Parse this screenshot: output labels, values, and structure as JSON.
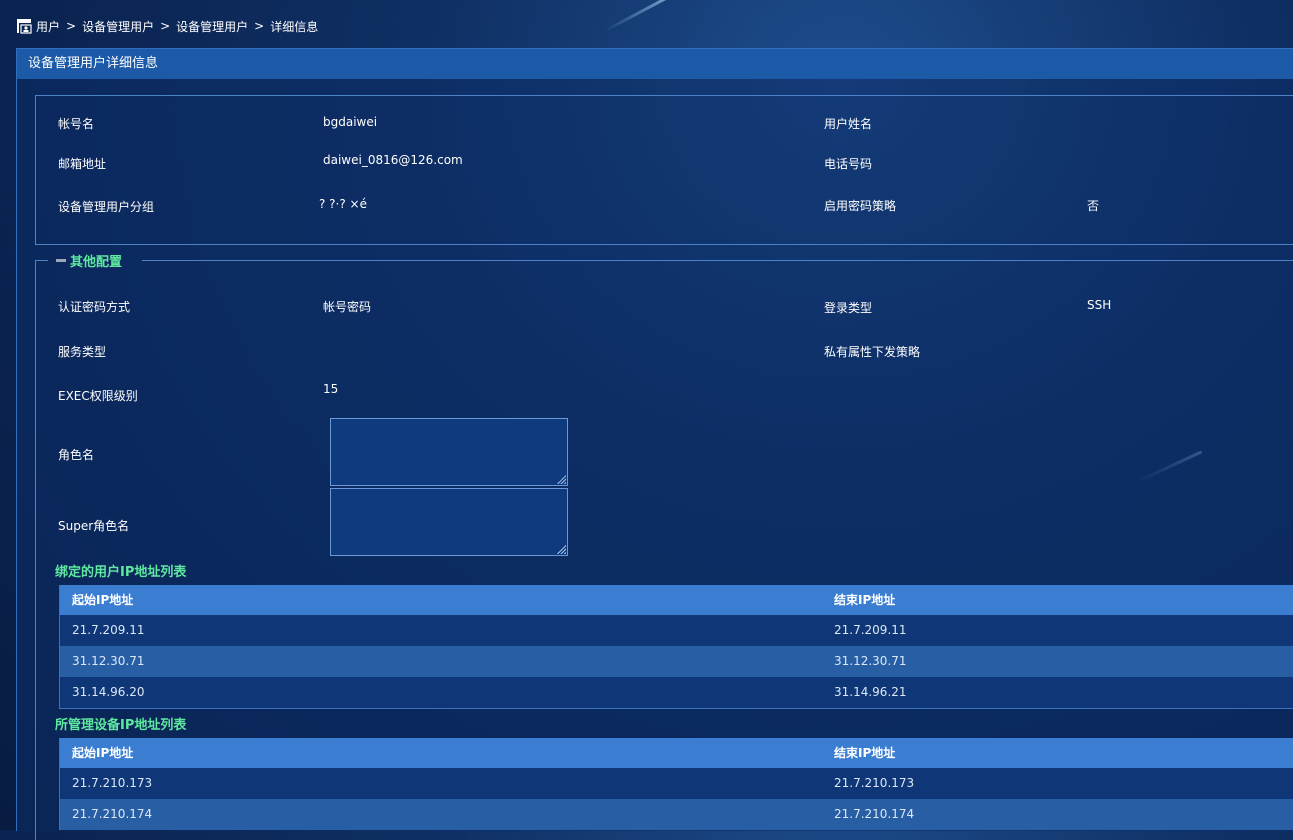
{
  "breadcrumb": {
    "items": [
      "用户",
      "设备管理用户",
      "设备管理用户",
      "详细信息"
    ],
    "separator": ">"
  },
  "panel": {
    "title": "设备管理用户详细信息"
  },
  "info": {
    "account_label": "帐号名",
    "account_value": "bgdaiwei",
    "username_label": "用户姓名",
    "username_value": "",
    "email_label": "邮箱地址",
    "email_value": "daiwei_0816@126.com",
    "phone_label": "电话号码",
    "phone_value": "",
    "group_label": "设备管理用户分组",
    "group_value": "? ?·? ×é",
    "pwd_policy_label": "启用密码策略",
    "pwd_policy_value": "否"
  },
  "other": {
    "legend": "其他配置",
    "auth_label": "认证密码方式",
    "auth_value": "帐号密码",
    "login_type_label": "登录类型",
    "login_type_value": "SSH",
    "service_type_label": "服务类型",
    "service_type_value": "",
    "private_attr_label": "私有属性下发策略",
    "private_attr_value": "",
    "exec_label": "EXEC权限级别",
    "exec_value": "15",
    "role_label": "角色名",
    "role_value": "",
    "super_role_label": "Super角色名",
    "super_role_value": ""
  },
  "user_ip_table": {
    "title": "绑定的用户IP地址列表",
    "headers": [
      "起始IP地址",
      "结束IP地址"
    ],
    "rows": [
      [
        "21.7.209.11",
        "21.7.209.11"
      ],
      [
        "31.12.30.71",
        "31.12.30.71"
      ],
      [
        "31.14.96.20",
        "31.14.96.21"
      ]
    ]
  },
  "device_ip_table": {
    "title": "所管理设备IP地址列表",
    "headers": [
      "起始IP地址",
      "结束IP地址"
    ],
    "rows": [
      [
        "21.7.210.173",
        "21.7.210.173"
      ],
      [
        "21.7.210.174",
        "21.7.210.174"
      ]
    ]
  },
  "colors": {
    "background": "#0f2f63",
    "header_bar": "#1c5aa8",
    "accent_green": "#5ee8a0",
    "table_header": "#3b7dd0",
    "row_odd": "#0f3676",
    "row_even": "#285ea4"
  },
  "icons": {
    "breadcrumb": "user-management-icon",
    "legend": "collapse-icon"
  }
}
